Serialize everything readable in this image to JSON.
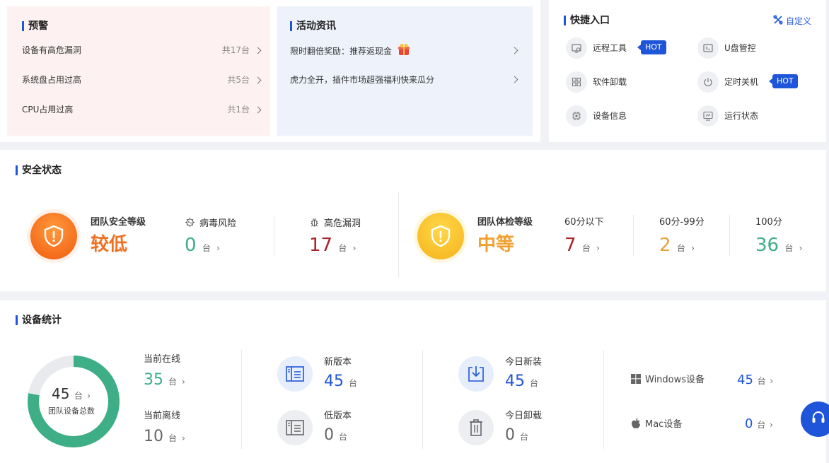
{
  "alerts": {
    "title": "预警",
    "items": [
      {
        "label": "设备有高危漏洞",
        "count": "共17台"
      },
      {
        "label": "系统盘占用过高",
        "count": "共5台"
      },
      {
        "label": "CPU占用过高",
        "count": "共1台"
      }
    ]
  },
  "news": {
    "title": "活动资讯",
    "items": [
      {
        "label": "限时翻倍奖励：推荐返现金"
      },
      {
        "label": "虎力全开，插件市场超强福利快来瓜分"
      }
    ]
  },
  "quick": {
    "title": "快捷入口",
    "customize": "自定义",
    "hot_label": "HOT",
    "items": [
      {
        "label": "远程工具",
        "icon": "remote-tool-icon",
        "hot": true
      },
      {
        "label": "U盘管控",
        "icon": "usb-control-icon",
        "hot": false
      },
      {
        "label": "软件卸载",
        "icon": "software-uninstall-icon",
        "hot": false
      },
      {
        "label": "定时关机",
        "icon": "power-icon",
        "hot": true
      },
      {
        "label": "设备信息",
        "icon": "chip-icon",
        "hot": false
      },
      {
        "label": "运行状态",
        "icon": "monitor-icon",
        "hot": false
      }
    ]
  },
  "security": {
    "title": "安全状态",
    "team_level_label": "团队安全等级",
    "team_level_value": "较低",
    "virus_label": "病毒风险",
    "virus_count": "0",
    "vuln_label": "高危漏洞",
    "vuln_count": "17",
    "check_level_label": "团队体检等级",
    "check_level_value": "中等",
    "below60_label": "60分以下",
    "below60_count": "7",
    "mid_label": "60分-99分",
    "mid_count": "2",
    "full_label": "100分",
    "full_count": "36",
    "unit": "台"
  },
  "devices": {
    "title": "设备统计",
    "total": "45",
    "total_label": "团队设备总数",
    "online_label": "当前在线",
    "online_count": "35",
    "offline_label": "当前离线",
    "offline_count": "10",
    "online_fraction": 0.778,
    "new_version_label": "新版本",
    "new_version_count": "45",
    "old_version_label": "低版本",
    "old_version_count": "0",
    "today_install_label": "今日新装",
    "today_install_count": "45",
    "today_uninstall_label": "今日卸载",
    "today_uninstall_count": "0",
    "windows_label": "Windows设备",
    "windows_count": "45",
    "mac_label": "Mac设备",
    "mac_count": "0",
    "unit": "台"
  },
  "colors": {
    "accent": "#1f55d9",
    "green": "#3dae86",
    "red": "#a8242a",
    "orange": "#f07020",
    "amber": "#e8a23a"
  }
}
